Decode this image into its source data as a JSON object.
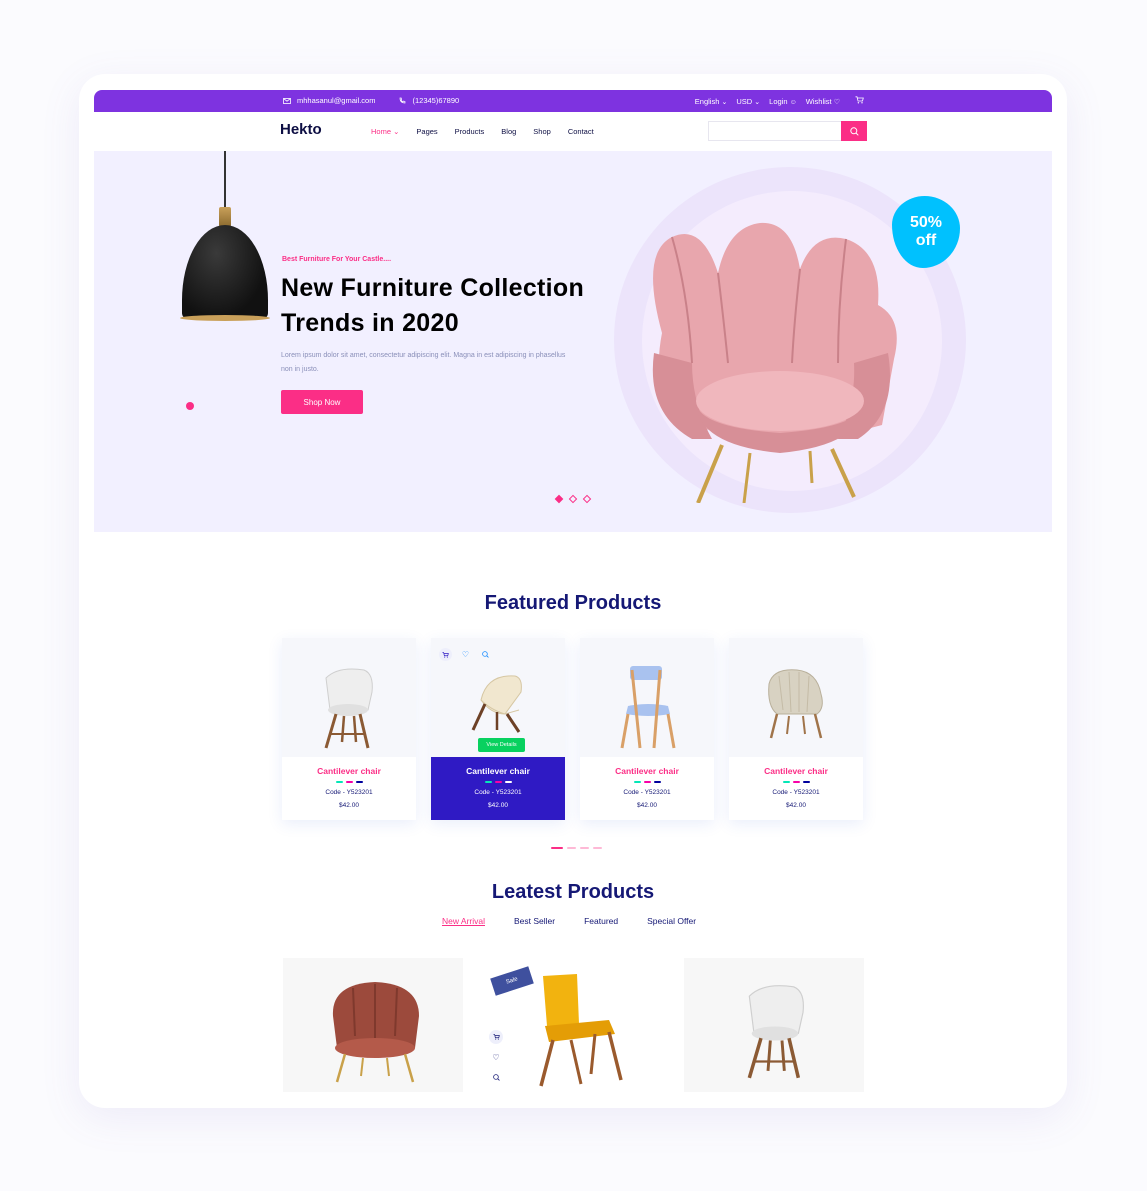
{
  "topbar": {
    "email": "mhhasanul@gmail.com",
    "phone": "(12345)67890",
    "language": "English",
    "currency": "USD",
    "login": "Login",
    "wishlist": "Wishlist"
  },
  "nav": {
    "logo": "Hekto",
    "items": [
      "Home",
      "Pages",
      "Products",
      "Blog",
      "Shop",
      "Contact"
    ],
    "search_placeholder": ""
  },
  "hero": {
    "kicker": "Best Furniture For Your Castle....",
    "title": "New Furniture Collection Trends in 2020",
    "description": "Lorem ipsum dolor sit amet, consectetur adipiscing elit. Magna in est adipiscing in phasellus non in justo.",
    "cta": "Shop Now",
    "badge_line1": "50%",
    "badge_line2": "off",
    "slides": 3,
    "active_slide": 1
  },
  "featured": {
    "title": "Featured Products",
    "view_details": "View Details",
    "products": [
      {
        "name": "Cantilever chair",
        "code": "Code - Y523201",
        "price": "$42.00"
      },
      {
        "name": "Cantilever chair",
        "code": "Code - Y523201",
        "price": "$42.00"
      },
      {
        "name": "Cantilever chair",
        "code": "Code - Y523201",
        "price": "$42.00"
      },
      {
        "name": "Cantilever chair",
        "code": "Code - Y523201",
        "price": "$42.00"
      }
    ],
    "swatch_colors": [
      "#05e6b7",
      "#f701a8",
      "#00009d"
    ],
    "highlighted_index": 1
  },
  "latest": {
    "title": "Leatest Products",
    "tabs": [
      "New Arrival",
      "Best Seller",
      "Featured",
      "Special Offer"
    ],
    "active_tab": 0,
    "sale_label": "Sale"
  },
  "colors": {
    "topbar": "#7e33e0",
    "accent": "#fb2e86",
    "navy": "#151875",
    "highlight_card": "#2f1ac4",
    "badge": "#00c1fe"
  }
}
